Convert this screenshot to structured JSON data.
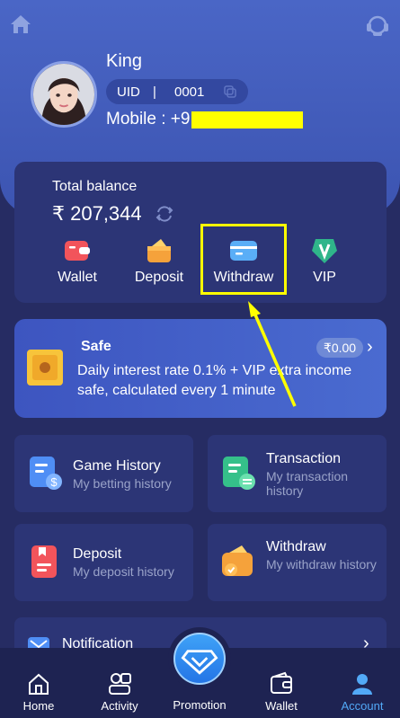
{
  "profile": {
    "username": "King",
    "uid_label": "UID",
    "uid_separator": "|",
    "uid_value": "0001",
    "mobile_label": "Mobile : +9"
  },
  "balance": {
    "title": "Total balance",
    "amount": "₹ 207,344",
    "actions": [
      {
        "label": "Wallet",
        "icon": "wallet-icon"
      },
      {
        "label": "Deposit",
        "icon": "deposit-icon"
      },
      {
        "label": "Withdraw",
        "icon": "withdraw-card-icon"
      },
      {
        "label": "VIP",
        "icon": "vip-icon"
      }
    ]
  },
  "safe": {
    "title": "Safe",
    "badge": "₹0.00",
    "description": "Daily interest rate 0.1% + VIP extra income safe, calculated every 1 minute"
  },
  "tiles": [
    {
      "title": "Game History",
      "subtitle": "My betting history"
    },
    {
      "title": "Transaction",
      "subtitle": "My transaction history"
    },
    {
      "title": "Deposit",
      "subtitle": "My deposit history"
    },
    {
      "title": "Withdraw",
      "subtitle": "My withdraw history"
    }
  ],
  "notification": {
    "label": "Notification"
  },
  "tabbar": {
    "home": "Home",
    "activity": "Activity",
    "promotion": "Promotion",
    "wallet": "Wallet",
    "account": "Account"
  },
  "colors": {
    "background": "#262c63",
    "header": "#4a66c6",
    "card": "#2c3576",
    "accent": "#52a9f7",
    "highlight": "#ffff00"
  }
}
